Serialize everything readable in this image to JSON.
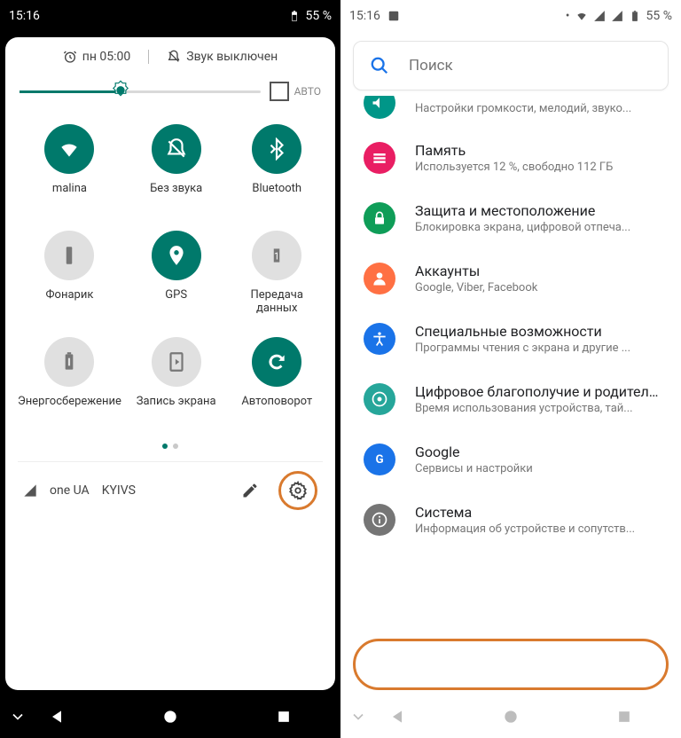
{
  "left": {
    "status": {
      "time": "15:16",
      "battery": "55 %"
    },
    "alarm": "пн 05:00",
    "sound_status": "Звук выключен",
    "auto_label": "АВТО",
    "tiles": [
      {
        "label": "malina",
        "icon": "wifi",
        "on": true
      },
      {
        "label": "Без звука",
        "icon": "nosound",
        "on": true
      },
      {
        "label": "Bluetooth",
        "icon": "bluetooth",
        "on": true
      },
      {
        "label": "Фонарик",
        "icon": "flashlight",
        "on": false
      },
      {
        "label": "GPS",
        "icon": "gps",
        "on": true
      },
      {
        "label": "Передача данных",
        "icon": "data",
        "on": false
      },
      {
        "label": "Энергосбережение",
        "icon": "battery",
        "on": false
      },
      {
        "label": "Запись экрана",
        "icon": "record",
        "on": false
      },
      {
        "label": "Автоповорот",
        "icon": "rotate",
        "on": true
      }
    ],
    "carrier1": "one UA",
    "carrier2": "KYIVS"
  },
  "right": {
    "status": {
      "time": "15:16",
      "battery": "55 %"
    },
    "search_placeholder": "Поиск",
    "partial_row": {
      "sub": "Настройки громкости, мелодий, звуко..."
    },
    "rows": [
      {
        "title": "Память",
        "sub": "Используется 12 %, свободно 112 ГБ",
        "color": "col-pink",
        "icon": "storage"
      },
      {
        "title": "Защита и местоположение",
        "sub": "Блокировка экрана, цифровой отпеча...",
        "color": "col-green",
        "icon": "lock"
      },
      {
        "title": "Аккаунты",
        "sub": "Google, Viber, Facebook",
        "color": "col-orange",
        "icon": "person"
      },
      {
        "title": "Специальные возможности",
        "sub": "Программы чтения с экрана и другие ...",
        "color": "col-blue",
        "icon": "a11y"
      },
      {
        "title": "Цифровое благополучие и родитель...",
        "sub": "Время использования устройства, тай...",
        "color": "col-teal2",
        "icon": "wellbeing"
      },
      {
        "title": "Google",
        "sub": "Сервисы и настройки",
        "color": "col-blue",
        "icon": "google"
      },
      {
        "title": "Система",
        "sub": "Информация об устройстве и сопутств...",
        "color": "col-grey",
        "icon": "info"
      }
    ]
  }
}
